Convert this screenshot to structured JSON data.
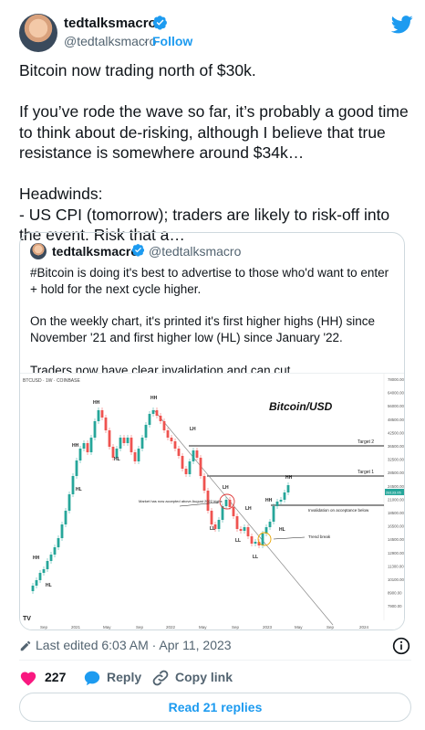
{
  "author": {
    "name": "tedtalksmacro",
    "handle": "@tedtalksmacro",
    "follow_label": "Follow",
    "separator": "·"
  },
  "tweet": {
    "text": "Bitcoin now trading north of $30k.\n\nIf you’ve rode the wave so far, it’s probably a good time to think about de-risking, although I believe that true resistance is somewhere around $34k…\n\nHeadwinds:\n- US CPI (tomorrow); traders are likely to risk-off into the event. Risk that a…"
  },
  "quote": {
    "name": "tedtalksmacro",
    "handle": "@tedtalksmacro",
    "text": "#Bitcoin is doing it's best to advertise to those who'd want to enter + hold for the next cycle higher.\n\nOn the weekly chart, it's printed it's first higher highs (HH) since November '21 and first higher low (HL) since January '22.\n\nTraders now have clear invalidation and can cut…",
    "chart": {
      "symbol": "BTCUSD · 1W · COINBASE",
      "title": "Bitcoin/USD",
      "target2": "Target 2",
      "target1": "Target 1",
      "invalidation": "Invalidation on acceptance below",
      "trend_break": "Trend break",
      "accepted": "Market has now accepted above August 2022 highs",
      "x_ticks": [
        "Sep",
        "2021",
        "May",
        "Sep",
        "2022",
        "May",
        "Sep",
        "2023",
        "May",
        "Sep",
        "2024"
      ],
      "y_ticks": [
        "78000.00",
        "64000.00",
        "56000.00",
        "48500.00",
        "42500.00",
        "36500.00",
        "32500.00",
        "28500.00",
        "24500.00",
        "21000.00",
        "18500.00",
        "16500.00",
        "14500.00",
        "12900.00",
        "11300.00",
        "10100.00",
        "8900.00",
        "7900.00"
      ],
      "price_label": "28133.05"
    }
  },
  "footer": {
    "edited": "Last edited 6:03 AM · Apr 11, 2023",
    "likes": "227",
    "reply_label": "Reply",
    "copy_label": "Copy link",
    "read_replies": "Read 21 replies"
  },
  "colors": {
    "accent": "#1d9bf0",
    "heart": "#f91880",
    "candle_up": "#26a69a",
    "candle_down": "#ef5350"
  }
}
